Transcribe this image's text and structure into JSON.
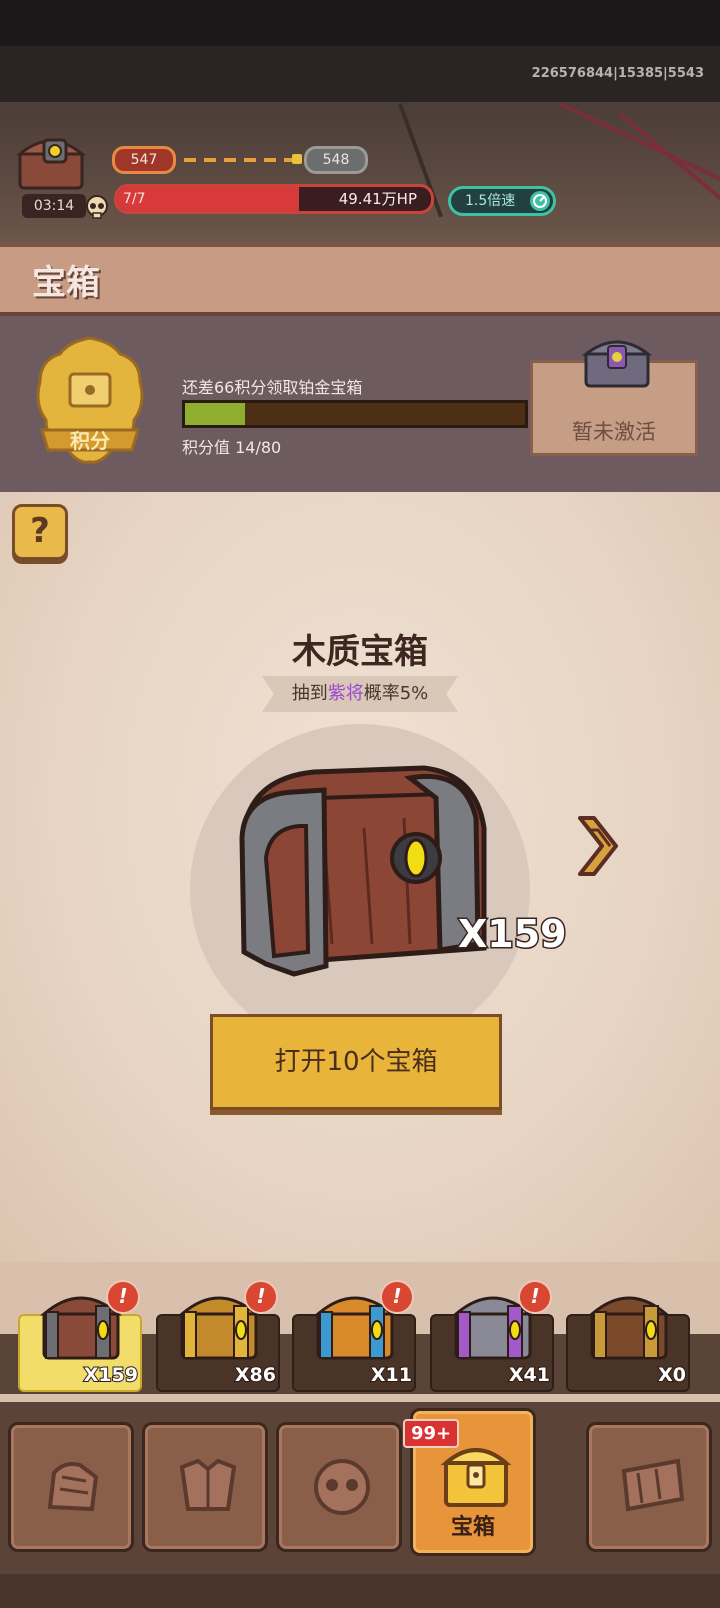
{
  "build_id": "226576844|15385|5543",
  "battle": {
    "timer": "03:14",
    "level_current": "547",
    "level_next": "548",
    "wave": "7/7",
    "hp": "49.41万HP",
    "hp_fraction": 0.58,
    "speed": "1.5倍速"
  },
  "page_title": "宝箱",
  "points": {
    "badge_label": "积分",
    "message": "还差66积分领取铂金宝箱",
    "value_label": "积分值",
    "value": "14/80",
    "fraction": 0.175,
    "inactive_label": "暂未激活"
  },
  "chest": {
    "name": "木质宝箱",
    "prob_prefix": "抽到",
    "prob_highlight": "紫将",
    "prob_suffix": "概率5%",
    "count": "X159",
    "open_button": "打开10个宝箱"
  },
  "slots": [
    {
      "count": "X159",
      "alert": "!",
      "color": "#8a4a3a",
      "band": "#6d6e74",
      "selected": true
    },
    {
      "count": "X86",
      "alert": "!",
      "color": "#c28a2a",
      "band": "#e2b43a",
      "selected": false
    },
    {
      "count": "X11",
      "alert": "!",
      "color": "#d88a2a",
      "band": "#3d9ad0",
      "selected": false
    },
    {
      "count": "X41",
      "alert": "!",
      "color": "#8a8a96",
      "band": "#a35ac8",
      "selected": false
    },
    {
      "count": "X0",
      "alert": "",
      "color": "#7a4a2a",
      "band": "#c89a3a",
      "selected": false
    }
  ],
  "nav": {
    "badge": "99+",
    "active_label": "宝箱"
  },
  "colors": {
    "accent_gold": "#e8b53a",
    "hp_red": "#d8393a",
    "points_green": "#8fae2d",
    "purple_rarity": "#9b48d4"
  }
}
